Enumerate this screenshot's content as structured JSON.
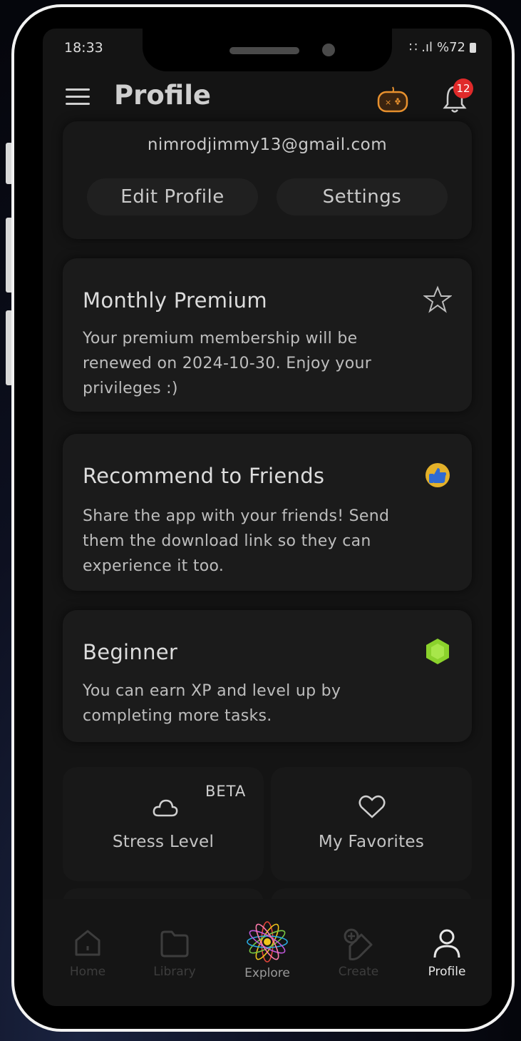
{
  "status_bar": {
    "time": "18:33",
    "signal": "∷ .ıl",
    "battery": "%72"
  },
  "header": {
    "title": "Profile",
    "notification_count": "12"
  },
  "account": {
    "email": "nimrodjimmy13@gmail.com",
    "edit_label": "Edit Profile",
    "settings_label": "Settings"
  },
  "cards": [
    {
      "title": "Monthly Premium",
      "description": "Your premium membership will be renewed on 2024-10-30. Enjoy your privileges :)",
      "icon": "star-outline-icon"
    },
    {
      "title": "Recommend to Friends",
      "description": "Share the app with your friends! Send them the download link so they can experience it too.",
      "icon": "thumbs-up-badge-icon"
    },
    {
      "title": "Beginner",
      "description": "You can earn XP and level up by completing more tasks.",
      "icon": "green-hexagon-icon"
    }
  ],
  "tiles": [
    {
      "label": "Stress Level",
      "tag": "BETA",
      "icon": "cloud-icon"
    },
    {
      "label": "My Favorites",
      "icon": "heart-icon"
    }
  ],
  "nav": [
    {
      "label": "Home",
      "icon": "home-icon"
    },
    {
      "label": "Library",
      "icon": "folder-icon"
    },
    {
      "label": "Explore",
      "icon": "mandala-icon"
    },
    {
      "label": "Create",
      "icon": "create-icon"
    },
    {
      "label": "Profile",
      "icon": "person-icon",
      "active": true
    }
  ],
  "colors": {
    "badge": "#e02a2a",
    "gamepad_accent": "#e8912e",
    "beginner_hex": "#8bd22c",
    "background": "#141414"
  }
}
